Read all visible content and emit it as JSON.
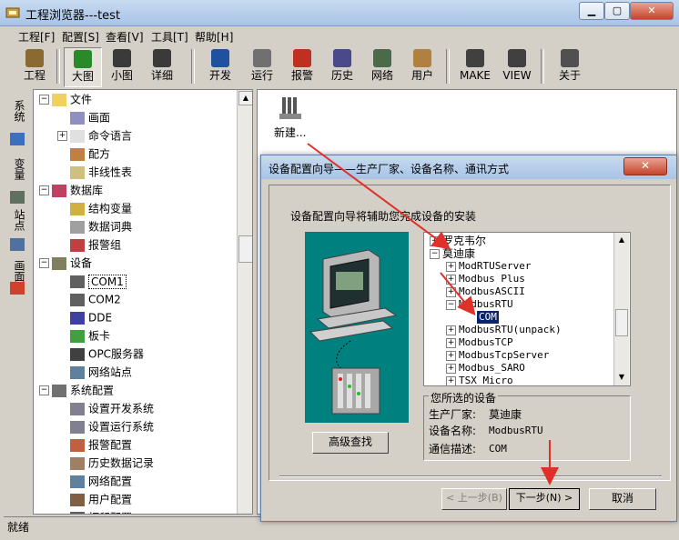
{
  "window": {
    "title": "工程浏览器---test"
  },
  "menu": [
    {
      "label": "工程[F]"
    },
    {
      "label": "配置[S]"
    },
    {
      "label": "查看[V]"
    },
    {
      "label": "工具[T]"
    },
    {
      "label": "帮助[H]"
    }
  ],
  "toolbar": [
    {
      "label": "工程",
      "icon": "project-icon"
    },
    {
      "label": "大图",
      "icon": "large-icons-icon",
      "pressed": true
    },
    {
      "label": "小图",
      "icon": "small-icons-icon"
    },
    {
      "label": "详细",
      "icon": "details-icon"
    },
    {
      "label": "开发",
      "icon": "develop-icon"
    },
    {
      "label": "运行",
      "icon": "run-icon"
    },
    {
      "label": "报警",
      "icon": "alarm-icon"
    },
    {
      "label": "历史",
      "icon": "history-icon"
    },
    {
      "label": "网络",
      "icon": "network-icon"
    },
    {
      "label": "用户",
      "icon": "user-icon"
    },
    {
      "label": "MAKE",
      "icon": "make-icon"
    },
    {
      "label": "VIEW",
      "icon": "view-icon"
    },
    {
      "label": "关于",
      "icon": "about-icon"
    }
  ],
  "vtabs": [
    {
      "label": "系统"
    },
    {
      "label": "变量"
    },
    {
      "label": "站点"
    },
    {
      "label": "画面"
    }
  ],
  "tree": [
    {
      "label": "文件",
      "level": 0,
      "exp": "-",
      "icon": "folder-icon"
    },
    {
      "label": "画面",
      "level": 1,
      "icon": "screen-icon"
    },
    {
      "label": "命令语言",
      "level": 1,
      "exp": "+",
      "icon": "command-icon"
    },
    {
      "label": "配方",
      "level": 1,
      "icon": "recipe-icon"
    },
    {
      "label": "非线性表",
      "level": 1,
      "icon": "table-icon"
    },
    {
      "label": "数据库",
      "level": 0,
      "exp": "-",
      "icon": "database-icon"
    },
    {
      "label": "结构变量",
      "level": 1,
      "icon": "struct-icon"
    },
    {
      "label": "数据词典",
      "level": 1,
      "icon": "dictionary-icon"
    },
    {
      "label": "报警组",
      "level": 1,
      "icon": "alarm-group-icon"
    },
    {
      "label": "设备",
      "level": 0,
      "exp": "-",
      "icon": "device-icon"
    },
    {
      "label": "COM1",
      "level": 1,
      "icon": "com-icon",
      "selected": true
    },
    {
      "label": "COM2",
      "level": 1,
      "icon": "com-icon"
    },
    {
      "label": "DDE",
      "level": 1,
      "icon": "dde-icon"
    },
    {
      "label": "板卡",
      "level": 1,
      "icon": "board-icon"
    },
    {
      "label": "OPC服务器",
      "level": 1,
      "icon": "opc-icon"
    },
    {
      "label": "网络站点",
      "level": 1,
      "icon": "network-site-icon"
    },
    {
      "label": "系统配置",
      "level": 0,
      "exp": "-",
      "icon": "tools-icon"
    },
    {
      "label": "设置开发系统",
      "level": 1,
      "icon": "settings-icon"
    },
    {
      "label": "设置运行系统",
      "level": 1,
      "icon": "settings-icon"
    },
    {
      "label": "报警配置",
      "level": 1,
      "icon": "alarm-config-icon"
    },
    {
      "label": "历史数据记录",
      "level": 1,
      "icon": "history-record-icon"
    },
    {
      "label": "网络配置",
      "level": 1,
      "icon": "network-config-icon"
    },
    {
      "label": "用户配置",
      "level": 1,
      "icon": "user-config-icon"
    },
    {
      "label": "打印配置",
      "level": 1,
      "icon": "print-icon"
    }
  ],
  "content": {
    "new_item": "新建..."
  },
  "status": "就绪",
  "dialog": {
    "title": "设备配置向导——生产厂家、设备名称、通讯方式",
    "intro": "设备配置向导将辅助您完成设备的安装",
    "device_tree": [
      {
        "label": "罗克韦尔",
        "level": 0,
        "exp": "+",
        "font": "cjk"
      },
      {
        "label": "莫迪康",
        "level": 0,
        "exp": "-",
        "font": "cjk"
      },
      {
        "label": "ModRTUServer",
        "level": 1,
        "exp": "+"
      },
      {
        "label": "Modbus Plus",
        "level": 1,
        "exp": "+"
      },
      {
        "label": "ModbusASCII",
        "level": 1,
        "exp": "+"
      },
      {
        "label": "ModbusRTU",
        "level": 1,
        "exp": "-"
      },
      {
        "label": "COM",
        "level": 2,
        "selected": true
      },
      {
        "label": "ModbusRTU(unpack)",
        "level": 1,
        "exp": "+"
      },
      {
        "label": "ModbusTCP",
        "level": 1,
        "exp": "+"
      },
      {
        "label": "ModbusTcpServer",
        "level": 1,
        "exp": "+"
      },
      {
        "label": "Modbus_SARO",
        "level": 1,
        "exp": "+"
      },
      {
        "label": "TSX Micro",
        "level": 1,
        "exp": "+"
      }
    ],
    "selected_group": "您所选的设备",
    "manufacturer_label": "生产厂家:",
    "manufacturer_value": "莫迪康",
    "device_label": "设备名称:",
    "device_value": "ModbusRTU",
    "comm_label": "通信描述:",
    "comm_value": "COM",
    "advanced_btn": "高级查找",
    "prev_btn": "< 上一步(B)",
    "next_btn": "下一步(N) >",
    "cancel_btn": "取消"
  },
  "colors": {
    "arrow": "#e0302a",
    "selection": "#0a246a",
    "illustration_bg": "#00807f"
  }
}
